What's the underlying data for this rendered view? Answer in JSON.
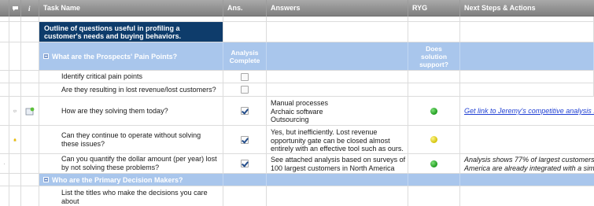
{
  "header": {
    "task_name": "Task Name",
    "ans": "Ans.",
    "answers": "Answers",
    "ryg": "RYG",
    "next_steps": "Next Steps & Actions"
  },
  "outline_note": "Outline of questions useful in profiling a customer's needs and buying behaviors.",
  "section1": {
    "title": "What are the Prospects' Pain Points?",
    "col_ans": "Analysis Complete",
    "col_ryg": "Does solution support?"
  },
  "rows": [
    {
      "task": "Identify critical pain points",
      "checked": false
    },
    {
      "task": "Are they resulting in lost revenue/lost customers?",
      "checked": false
    },
    {
      "task": "How are they solving them today?",
      "checked": true,
      "answers": [
        "Manual processes",
        "Archaic software",
        "Outsourcing"
      ],
      "status": "green",
      "next": "Get link to Jeremy's competitive analysis ..."
    },
    {
      "task": "Can they continue to operate without solving these issues?",
      "checked": true,
      "answers": [
        "Yes, but inefficiently. Lost revenue",
        "opportunity gate can be closed almost",
        "entirely with an effective tool such as ours."
      ],
      "status": "yellow"
    },
    {
      "task": "Can you quantify the dollar amount (per year) lost by not solving these problems?",
      "checked": true,
      "answers": [
        "See attached analysis based on surveys of",
        "100 largest customers in North America"
      ],
      "status": "green",
      "next": [
        "Analysis shows 77% of largest customers",
        "America are already integrated with a simi"
      ]
    }
  ],
  "section2": {
    "title": "Who are the Primary Decision Makers?"
  },
  "row_last": {
    "task": "List the titles who make the decisions you care about"
  },
  "colors": {
    "header": "#8f8f8f",
    "section": "#a9c6ec",
    "outline": "#0e3c6b",
    "link": "#1f3fd3"
  }
}
